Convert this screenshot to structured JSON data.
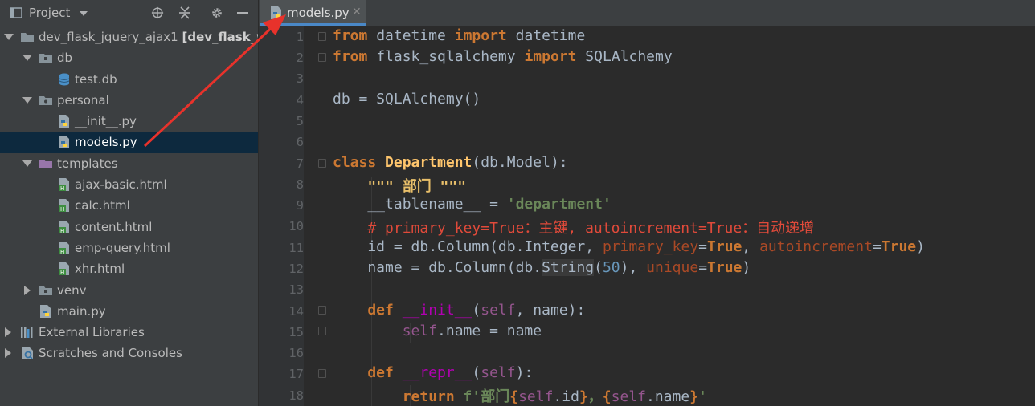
{
  "project_panel": {
    "title": "Project",
    "header_icons": [
      "locate-icon",
      "collapse-icon",
      "gear-icon",
      "minimize-icon"
    ]
  },
  "tree": {
    "root": {
      "name": "dev_flask_jquery_ajax1",
      "module": "[dev_flask_web"
    },
    "db_folder": "db",
    "test_db": "test.db",
    "personal_folder": "personal",
    "init_py": "__init__.py",
    "models_py": "models.py",
    "templates_folder": "templates",
    "ajax_basic": "ajax-basic.html",
    "calc": "calc.html",
    "content": "content.html",
    "emp_query": "emp-query.html",
    "xhr": "xhr.html",
    "venv_folder": "venv",
    "main_py": "main.py",
    "external_libraries": "External Libraries",
    "scratches": "Scratches and Consoles"
  },
  "editor": {
    "tab_label": "models.py",
    "close_glyph": "✕",
    "line_numbers": [
      "1",
      "2",
      "3",
      "4",
      "5",
      "6",
      "7",
      "8",
      "9",
      "10",
      "11",
      "12",
      "13",
      "14",
      "15",
      "16",
      "17",
      "18"
    ],
    "code": {
      "l1_from": "from",
      "l1_mod": " datetime ",
      "l1_import": "import",
      "l1_name": " datetime",
      "l2_from": "from",
      "l2_mod": " flask_sqlalchemy ",
      "l2_import": "import",
      "l2_name": " SQLAlchemy",
      "l4": "db = SQLAlchemy()",
      "l7_class": "class",
      "l7_name": " Department",
      "l7_base": "(db.Model):",
      "l8_doc": "    \"\"\" 部门 \"\"\"",
      "l9_a": "    __tablename__ = ",
      "l9_str": "'department'",
      "l10_cmt": "    # primary_key=True：主键, autoincrement=True：自动递增",
      "l11_a": "    id = db.Column(db.Integer, ",
      "l11_k1": "primary_key",
      "l11_e1": "=",
      "l11_t1": "True",
      "l11_c": ", ",
      "l11_k2": "autoincrement",
      "l11_e2": "=",
      "l11_t2": "True",
      "l11_z": ")",
      "l12_a": "    name = db.Column(db.",
      "l12_hl": "String",
      "l12_p": "(",
      "l12_num": "50",
      "l12_b": "), ",
      "l12_k": "unique",
      "l12_e": "=",
      "l12_t": "True",
      "l12_z": ")",
      "l14_def": "    def",
      "l14_sp": " ",
      "l14_fn": "__init__",
      "l14_p": "(",
      "l14_self": "self",
      "l14_rest": ", name):",
      "l15_self": "        self",
      "l15_rest": ".name = name",
      "l17_def": "    def",
      "l17_sp": " ",
      "l17_fn": "__repr__",
      "l17_p": "(",
      "l17_self": "self",
      "l17_rest": "):",
      "l18_ret": "        return",
      "l18_f": " f'部门",
      "l18_b1": "{",
      "l18_self1": "self",
      "l18_id": ".id",
      "l18_b2": "}",
      "l18_sep": "，",
      "l18_b3": "{",
      "l18_self2": "self",
      "l18_name": ".name",
      "l18_b4": "}",
      "l18_end": "'"
    }
  },
  "colors": {
    "annotation_arrow": "#e8322b",
    "selection": "#0d293e",
    "tab_underline": "#4a88c7"
  }
}
